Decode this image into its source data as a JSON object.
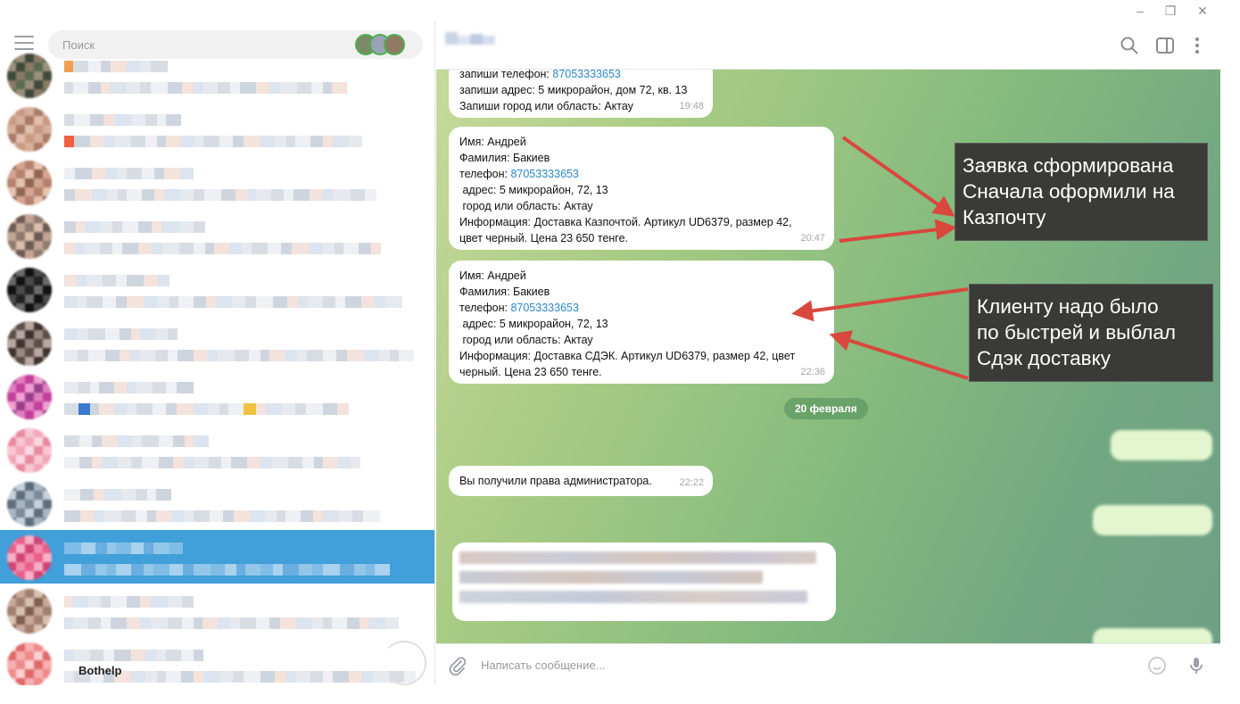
{
  "sidebar": {
    "search_placeholder": "Поиск",
    "bottom_chat_name": "Bothelp"
  },
  "chat": {
    "messages": [
      {
        "lines": [
          "запиши телефон: ",
          "запиши адрес: 5 микрорайон, дом 72, кв. 13",
          "Запиши город или область: Актау"
        ],
        "phone": "87053333653",
        "time": "19:48"
      },
      {
        "lines": [
          "Имя: Андрей",
          "Фамилия: Бакиев",
          "телефон: ",
          " адрес: 5 микрорайон, 72, 13",
          " город или область: Актау",
          "Информация: Доставка Казпочтой. Артикул UD6379, размер 42,",
          "цвет черный. Цена 23 650 тенге."
        ],
        "phone": "87053333653",
        "time": "20:47"
      },
      {
        "lines": [
          "Имя: Андрей",
          "Фамилия: Бакиев",
          "телефон: ",
          " адрес: 5 микрорайон, 72, 13",
          " город или область: Актау",
          "Информация: Доставка СДЭК. Артикул UD6379, размер 42, цвет",
          "черный. Цена 23 650 тенге."
        ],
        "phone": "87053333653",
        "time": "22:36"
      }
    ],
    "date_divider": "20 февраля",
    "admin_message": {
      "text": "Вы получили права администратора.",
      "time": "22:22"
    },
    "composer_placeholder": "Написать сообщение..."
  },
  "annotations": [
    {
      "lines": [
        "Заявка сформирована",
        "Сначала оформили на",
        "Казпочту"
      ]
    },
    {
      "lines": [
        "Клиенту надо было",
        "по быстрей и выблал",
        "Сдэк доставку"
      ]
    }
  ],
  "colors": {
    "accent": "#419fd9",
    "link": "#2b87c8",
    "arrow": "#d9473e",
    "callout_bg": "#3a3b39"
  },
  "icons": {
    "menu": "hamburger-icon",
    "search": "search-icon",
    "sidebar_toggle": "sidebar-panel-icon",
    "more": "more-vertical-icon",
    "attach": "paperclip-icon",
    "emoji": "emoji-icon",
    "mic": "microphone-icon"
  }
}
